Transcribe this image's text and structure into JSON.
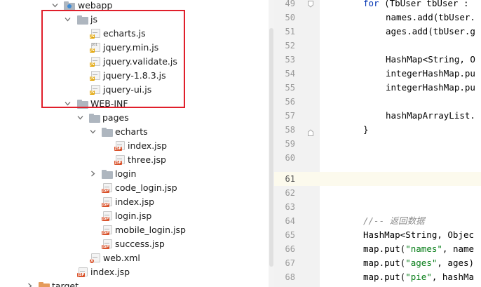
{
  "project_tree": {
    "items": [
      {
        "label": "webapp",
        "kind": "folder-web",
        "expanded": true
      },
      {
        "label": "js",
        "kind": "folder",
        "expanded": true
      },
      {
        "label": "echarts.js",
        "kind": "js"
      },
      {
        "label": "jquery.min.js",
        "kind": "js-min"
      },
      {
        "label": "jquery.validate.js",
        "kind": "js"
      },
      {
        "label": "jquery-1.8.3.js",
        "kind": "js"
      },
      {
        "label": "jquery-ui.js",
        "kind": "js"
      },
      {
        "label": "WEB-INF",
        "kind": "folder",
        "expanded": true
      },
      {
        "label": "pages",
        "kind": "folder",
        "expanded": true
      },
      {
        "label": "echarts",
        "kind": "folder",
        "expanded": true
      },
      {
        "label": "index.jsp",
        "kind": "jsp"
      },
      {
        "label": "three.jsp",
        "kind": "jsp"
      },
      {
        "label": "login",
        "kind": "folder",
        "expanded": false
      },
      {
        "label": "code_login.jsp",
        "kind": "jsp"
      },
      {
        "label": "index.jsp",
        "kind": "jsp"
      },
      {
        "label": "login.jsp",
        "kind": "jsp"
      },
      {
        "label": "mobile_login.jsp",
        "kind": "jsp"
      },
      {
        "label": "success.jsp",
        "kind": "jsp"
      },
      {
        "label": "web.xml",
        "kind": "xml"
      },
      {
        "label": "index.jsp",
        "kind": "jsp"
      },
      {
        "label": "target",
        "kind": "folder-target",
        "expanded": false
      }
    ],
    "badges": {
      "js": "JS",
      "jsp": "JSP",
      "xml": "X",
      "min": "101"
    }
  },
  "editor": {
    "line_numbers": [
      "49",
      "50",
      "51",
      "52",
      "53",
      "54",
      "55",
      "56",
      "57",
      "58",
      "59",
      "60",
      "61",
      "62",
      "63",
      "64",
      "65",
      "66",
      "67",
      "68"
    ],
    "current_line": "61",
    "lines": {
      "l49_kw": "for",
      "l49_rest": " (TbUser tbUser :",
      "l50": "names.add(tbUser.",
      "l51": "ages.add(tbUser.g",
      "l53": "HashMap<String, O",
      "l54": "integerHashMap.pu",
      "l55": "integerHashMap.pu",
      "l57": "hashMapArrayList.",
      "l58": "}",
      "l65_cmt": "//-- 返回数据",
      "l66": "HashMap<String, Objec",
      "l67_a": "map.put(",
      "l67_str": "\"names\"",
      "l67_b": ", name",
      "l68_a": "map.put(",
      "l68_str": "\"ages\"",
      "l68_b": ", ages)",
      "l69_a": "map.put(",
      "l69_str": "\"pie\"",
      "l69_b": ", hashMa"
    },
    "colors": {
      "keyword": "#0033b3",
      "string": "#067d17",
      "comment": "#8c8c8c",
      "highlight_box": "#e01f2b"
    }
  }
}
